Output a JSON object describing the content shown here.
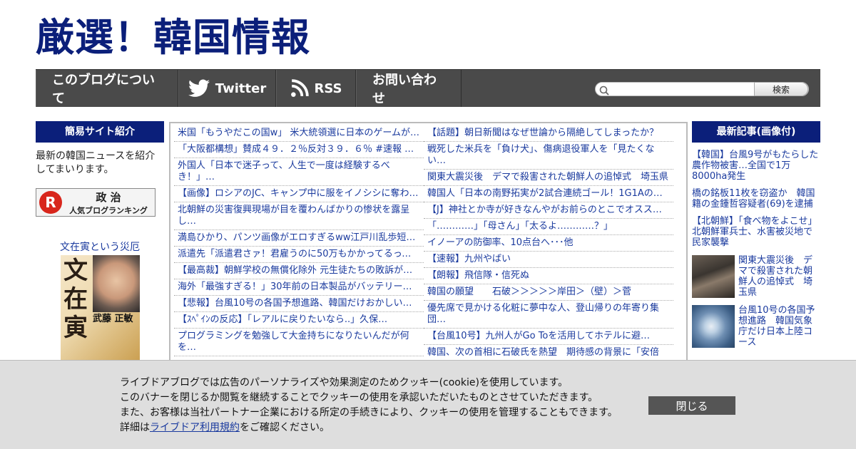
{
  "site": {
    "title": "厳選！韓国情報"
  },
  "nav": {
    "items": [
      {
        "label": "このブログについて",
        "icon": ""
      },
      {
        "label": "Twitter",
        "icon": "twitter-icon"
      },
      {
        "label": "RSS",
        "icon": "rss-icon"
      },
      {
        "label": "お問い合わせ",
        "icon": ""
      }
    ],
    "search": {
      "value": "",
      "placeholder": "",
      "button_label": "検索"
    }
  },
  "left_sidebar": {
    "header": "簡易サイト紹介",
    "intro": "最新の韓国ニュースを紹介してまいります。",
    "ranking_banner": {
      "logo": "R",
      "category": "政 治",
      "label": "人気ブログランキング"
    },
    "book": {
      "title": "文在寅という災厄",
      "cover_text_big": "文在寅",
      "cover_text_side": "武藤 正敏"
    }
  },
  "articles_left": [
    "米国「もうやだこの国w」 米大統領選に日本のゲームが…",
    "「大阪都構想」賛成４９．２％反対３９．６％ #速報 …",
    "外国人「日本で迷子って、人生で一度は経験するべき！」…",
    "【画像】ロシアのJC、キャンプ中に服をイノシシに奪わ…",
    "北朝鮮の災害復興現場が目を覆わんばかりの惨状を露呈し…",
    "満島ひかり、パンツ画像がエロすぎるww江戸川乱歩短編…",
    "派遣先「派遣君さァ！君雇うのに50万もかかってるって…",
    "【最高裁】朝鮮学校の無償化除外 元生徒たちの敗訴が確…",
    "海外「最強すぎる！」30年前の日本製品がバッテリーご…",
    "【悲報】台風10号の各国予想進路、韓国だけおかしいｗ…",
    "【ｽﾍﾟｲﾝの反応】「レアルに戻りたいなら..」久保…",
    "プログラミングを勉強して大金持ちになりたいんだが何を…"
  ],
  "articles_right": [
    "【話題】朝日新聞はなぜ世論から隔絶してしまったか？",
    "戦死した米兵を「負け犬」、傷病退役軍人を「見たくない…",
    "関東大震災後　デマで殺害された朝鮮人の追悼式　埼玉県",
    "韓国人「日本の南野拓実が2試合連続ゴール！1G1Aの…",
    "【J】神社とか寺が好きなんやがお前らのとこでオススメ…",
    "「…………」「母さん」「太るよ…………？」",
    "イノーアの防御率、10点台へ･･･他",
    "【速報】九州やばい",
    "【朗報】飛信隊・信死ぬ",
    "韓国の願望　　石破＞＞＞＞＞岸田＞（壁）＞菅",
    "優先席で見かける化粧に夢中な人、登山帰りの年寄り集団…",
    "【台風10号】九州人がGo Toを活用してホテルに避…",
    "韓国、次の首相に石破氏を熱望　期待感の背景に「安倍"
  ],
  "right_sidebar": {
    "header": "最新記事(画像付)",
    "text_items": [
      "【韓国】台風9号がもたらした農作物被害…全国で1万8000ha発生",
      "橋の銘板11枚を窃盗か　韓国籍の金鍾哲容疑者(69)を逮捕",
      "【北朝鮮】「食べ物をよこせ」　北朝鮮軍兵士、水害被災地で民家襲撃"
    ],
    "image_items": [
      "関東大震災後　デマで殺害された朝鮮人の追悼式　埼玉県",
      "台風10号の各国予想進路　韓国気象庁だけ日本上陸コース"
    ]
  },
  "cookie_banner": {
    "line1": "ライブドアブログでは広告のパーソナライズや効果測定のためクッキー(cookie)を使用しています。",
    "line2": "このバナーを閉じるか閲覧を継続することでクッキーの使用を承認いただいたものとさせていただきます。",
    "line3": "また、お客様は当社パートナー企業における所定の手続きにより、クッキーの使用を管理することもできます。",
    "line4_prefix": "詳細は",
    "line4_link": "ライブドア利用規約",
    "line4_suffix": "をご確認ください。",
    "close_label": "閉じる"
  },
  "colors": {
    "header_navy": "#0b1f7a",
    "nav_bg": "#4a4a4a",
    "link": "#1a3a9e"
  }
}
